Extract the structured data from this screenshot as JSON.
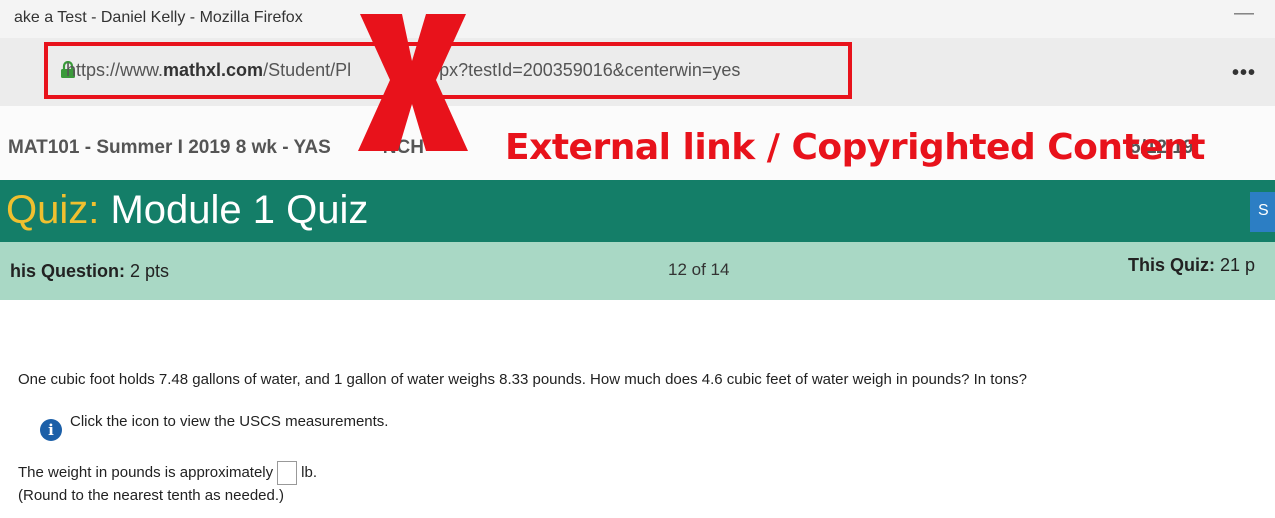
{
  "window": {
    "title": "ake a Test - Daniel Kelly - Mozilla Firefox",
    "minimize": "—"
  },
  "navbar": {
    "url_prefix": "https://www.",
    "url_domain": "mathxl.com",
    "url_rest": "/Student/Pl",
    "url_after_x": "est.aspx?testId=200359016&centerwin=yes",
    "overflow": "•••",
    "lock_icon": "lock-icon"
  },
  "course": {
    "name": "MAT101 - Summer I 2019 8 wk - YAS",
    "name_tail": "NCH",
    "right": "5/12/19"
  },
  "redaction": {
    "warning": "External link / Copyrighted Content",
    "color": "#e8121b"
  },
  "quiz": {
    "prefix": "Quiz:",
    "title": "Module 1 Quiz",
    "save_label": "S"
  },
  "info_bar": {
    "question_label": "his Question:",
    "question_points": "2 pts",
    "progress": "12 of 14",
    "quiz_label": "This Quiz:",
    "quiz_points": "21 p"
  },
  "question": {
    "text": "One cubic foot holds 7.48 gallons of water, and 1 gallon of water weighs 8.33 pounds. How much does 4.6 cubic feet of water weigh in pounds? In tons?",
    "hint": "Click the icon to view the USCS measurements.",
    "answer_prefix": "The weight in pounds is approximately",
    "answer_unit": "lb.",
    "round_note": "(Round to the nearest tenth as needed.)"
  },
  "colors": {
    "header_green": "#147e68",
    "info_bar": "#a9d8c5",
    "quiz_prefix": "#f0c02f"
  }
}
